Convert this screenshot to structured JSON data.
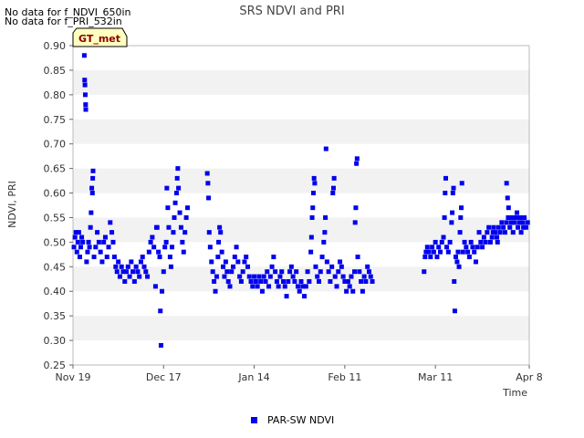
{
  "messages": [
    "No data for f_NDVI_650in",
    "No data for f_PRI_532in"
  ],
  "chart_data": {
    "type": "scatter",
    "title": "SRS NDVI and PRI",
    "xlabel": "Time",
    "ylabel": "NDVI, PRI",
    "site_badge": "GT_met",
    "ylim": [
      0.25,
      0.9
    ],
    "yticks": [
      "0.25",
      "0.30",
      "0.35",
      "0.40",
      "0.45",
      "0.50",
      "0.55",
      "0.60",
      "0.65",
      "0.70",
      "0.75",
      "0.80",
      "0.85",
      "0.90"
    ],
    "xlim_days": [
      0,
      141
    ],
    "xticks": [
      {
        "label": "Nov 19",
        "day": 0
      },
      {
        "label": "Dec 17",
        "day": 28
      },
      {
        "label": "Jan 14",
        "day": 56
      },
      {
        "label": "Feb 11",
        "day": 84
      },
      {
        "label": "Mar 11",
        "day": 112
      },
      {
        "label": "Apr 8",
        "day": 141
      }
    ],
    "grid": "alternating horizontal bands",
    "legend_position": "bottom-center",
    "colors": {
      "series": "#0000ee",
      "band": "#f2f2f2",
      "badge_fill": "#ffffc0"
    },
    "series": [
      {
        "name": "PAR-SW NDVI",
        "points": [
          [
            0.3,
            0.49
          ],
          [
            0.6,
            0.51
          ],
          [
            0.9,
            0.52
          ],
          [
            1.2,
            0.48
          ],
          [
            1.5,
            0.5
          ],
          [
            1.8,
            0.52
          ],
          [
            2.1,
            0.47
          ],
          [
            2.4,
            0.49
          ],
          [
            2.7,
            0.51
          ],
          [
            3.0,
            0.5
          ],
          [
            3.5,
            0.88
          ],
          [
            3.6,
            0.83
          ],
          [
            3.7,
            0.82
          ],
          [
            3.8,
            0.8
          ],
          [
            3.9,
            0.78
          ],
          [
            3.95,
            0.77
          ],
          [
            4.2,
            0.46
          ],
          [
            4.5,
            0.48
          ],
          [
            4.8,
            0.5
          ],
          [
            5.1,
            0.49
          ],
          [
            5.4,
            0.53
          ],
          [
            5.6,
            0.56
          ],
          [
            5.8,
            0.61
          ],
          [
            6.0,
            0.6
          ],
          [
            6.1,
            0.63
          ],
          [
            6.2,
            0.645
          ],
          [
            6.5,
            0.47
          ],
          [
            7.0,
            0.49
          ],
          [
            7.5,
            0.52
          ],
          [
            8.0,
            0.5
          ],
          [
            8.5,
            0.48
          ],
          [
            9.0,
            0.46
          ],
          [
            9.5,
            0.5
          ],
          [
            10.0,
            0.51
          ],
          [
            10.5,
            0.47
          ],
          [
            11.0,
            0.49
          ],
          [
            11.5,
            0.54
          ],
          [
            12.0,
            0.52
          ],
          [
            12.4,
            0.5
          ],
          [
            12.8,
            0.47
          ],
          [
            13.2,
            0.45
          ],
          [
            13.6,
            0.44
          ],
          [
            14.0,
            0.46
          ],
          [
            14.5,
            0.43
          ],
          [
            15.0,
            0.45
          ],
          [
            15.5,
            0.44
          ],
          [
            16.0,
            0.42
          ],
          [
            16.5,
            0.44
          ],
          [
            17.0,
            0.45
          ],
          [
            17.5,
            0.43
          ],
          [
            18.0,
            0.46
          ],
          [
            18.5,
            0.44
          ],
          [
            19.0,
            0.42
          ],
          [
            19.5,
            0.45
          ],
          [
            20.0,
            0.44
          ],
          [
            20.5,
            0.43
          ],
          [
            21.0,
            0.46
          ],
          [
            21.5,
            0.47
          ],
          [
            22.0,
            0.45
          ],
          [
            22.5,
            0.44
          ],
          [
            23.0,
            0.43
          ],
          [
            23.5,
            0.48
          ],
          [
            24.0,
            0.5
          ],
          [
            24.5,
            0.51
          ],
          [
            25.0,
            0.49
          ],
          [
            25.5,
            0.41
          ],
          [
            25.8,
            0.53
          ],
          [
            26.0,
            0.53
          ],
          [
            26.4,
            0.48
          ],
          [
            26.8,
            0.47
          ],
          [
            27.0,
            0.36
          ],
          [
            27.2,
            0.29
          ],
          [
            27.5,
            0.4
          ],
          [
            28.0,
            0.44
          ],
          [
            28.4,
            0.49
          ],
          [
            28.8,
            0.5
          ],
          [
            29.0,
            0.61
          ],
          [
            29.3,
            0.57
          ],
          [
            29.6,
            0.53
          ],
          [
            30.0,
            0.47
          ],
          [
            30.3,
            0.45
          ],
          [
            30.6,
            0.49
          ],
          [
            31.0,
            0.52
          ],
          [
            31.3,
            0.55
          ],
          [
            31.6,
            0.58
          ],
          [
            32.0,
            0.6
          ],
          [
            32.2,
            0.63
          ],
          [
            32.4,
            0.65
          ],
          [
            32.6,
            0.61
          ],
          [
            33.0,
            0.56
          ],
          [
            33.4,
            0.53
          ],
          [
            33.8,
            0.5
          ],
          [
            34.2,
            0.48
          ],
          [
            34.6,
            0.52
          ],
          [
            35.0,
            0.55
          ],
          [
            35.4,
            0.57
          ],
          [
            41.5,
            0.64
          ],
          [
            41.7,
            0.62
          ],
          [
            41.9,
            0.59
          ],
          [
            42.1,
            0.52
          ],
          [
            42.4,
            0.49
          ],
          [
            42.8,
            0.46
          ],
          [
            43.2,
            0.44
          ],
          [
            43.6,
            0.42
          ],
          [
            44.0,
            0.4
          ],
          [
            44.4,
            0.43
          ],
          [
            44.8,
            0.47
          ],
          [
            45.0,
            0.5
          ],
          [
            45.3,
            0.53
          ],
          [
            45.6,
            0.52
          ],
          [
            46.0,
            0.48
          ],
          [
            46.4,
            0.45
          ],
          [
            46.8,
            0.43
          ],
          [
            47.2,
            0.46
          ],
          [
            47.6,
            0.44
          ],
          [
            48.0,
            0.42
          ],
          [
            48.5,
            0.41
          ],
          [
            49.0,
            0.44
          ],
          [
            49.5,
            0.45
          ],
          [
            50.0,
            0.47
          ],
          [
            50.5,
            0.49
          ],
          [
            51.0,
            0.46
          ],
          [
            51.5,
            0.43
          ],
          [
            52.0,
            0.42
          ],
          [
            52.5,
            0.44
          ],
          [
            53.0,
            0.46
          ],
          [
            53.5,
            0.47
          ],
          [
            54.0,
            0.45
          ],
          [
            54.5,
            0.43
          ],
          [
            55.0,
            0.42
          ],
          [
            55.5,
            0.41
          ],
          [
            56.0,
            0.43
          ],
          [
            56.5,
            0.42
          ],
          [
            57.0,
            0.41
          ],
          [
            57.5,
            0.43
          ],
          [
            58.0,
            0.42
          ],
          [
            58.5,
            0.4
          ],
          [
            59.0,
            0.43
          ],
          [
            59.5,
            0.42
          ],
          [
            60.0,
            0.44
          ],
          [
            60.5,
            0.41
          ],
          [
            61.0,
            0.43
          ],
          [
            61.5,
            0.45
          ],
          [
            62.0,
            0.47
          ],
          [
            62.5,
            0.44
          ],
          [
            63.0,
            0.42
          ],
          [
            63.5,
            0.41
          ],
          [
            64.0,
            0.43
          ],
          [
            64.5,
            0.44
          ],
          [
            65.0,
            0.42
          ],
          [
            65.5,
            0.41
          ],
          [
            66.0,
            0.39
          ],
          [
            66.5,
            0.42
          ],
          [
            67.0,
            0.44
          ],
          [
            67.5,
            0.45
          ],
          [
            68.0,
            0.43
          ],
          [
            68.5,
            0.42
          ],
          [
            69.0,
            0.44
          ],
          [
            69.5,
            0.41
          ],
          [
            70.0,
            0.4
          ],
          [
            70.5,
            0.42
          ],
          [
            71.0,
            0.41
          ],
          [
            71.5,
            0.39
          ],
          [
            72.0,
            0.41
          ],
          [
            72.5,
            0.44
          ],
          [
            73.0,
            0.42
          ],
          [
            73.5,
            0.48
          ],
          [
            73.7,
            0.51
          ],
          [
            73.9,
            0.55
          ],
          [
            74.1,
            0.57
          ],
          [
            74.3,
            0.6
          ],
          [
            74.5,
            0.63
          ],
          [
            74.7,
            0.62
          ],
          [
            75.0,
            0.45
          ],
          [
            75.5,
            0.43
          ],
          [
            76.0,
            0.42
          ],
          [
            76.5,
            0.44
          ],
          [
            77.0,
            0.47
          ],
          [
            77.5,
            0.5
          ],
          [
            77.8,
            0.52
          ],
          [
            78.0,
            0.55
          ],
          [
            78.2,
            0.69
          ],
          [
            78.5,
            0.46
          ],
          [
            79.0,
            0.44
          ],
          [
            79.5,
            0.42
          ],
          [
            80.0,
            0.45
          ],
          [
            80.3,
            0.6
          ],
          [
            80.5,
            0.61
          ],
          [
            80.7,
            0.63
          ],
          [
            81.0,
            0.43
          ],
          [
            81.5,
            0.41
          ],
          [
            82.0,
            0.44
          ],
          [
            82.5,
            0.46
          ],
          [
            83.0,
            0.45
          ],
          [
            83.5,
            0.43
          ],
          [
            84.0,
            0.42
          ],
          [
            84.5,
            0.4
          ],
          [
            85.0,
            0.42
          ],
          [
            85.5,
            0.41
          ],
          [
            86.0,
            0.43
          ],
          [
            86.5,
            0.4
          ],
          [
            87.0,
            0.44
          ],
          [
            87.2,
            0.54
          ],
          [
            87.4,
            0.57
          ],
          [
            87.6,
            0.66
          ],
          [
            87.8,
            0.67
          ],
          [
            88.0,
            0.47
          ],
          [
            88.5,
            0.44
          ],
          [
            89.0,
            0.42
          ],
          [
            89.5,
            0.4
          ],
          [
            90.0,
            0.43
          ],
          [
            90.5,
            0.42
          ],
          [
            91.0,
            0.45
          ],
          [
            91.5,
            0.44
          ],
          [
            92.0,
            0.43
          ],
          [
            92.5,
            0.42
          ],
          [
            108.5,
            0.44
          ],
          [
            108.8,
            0.47
          ],
          [
            109.1,
            0.48
          ],
          [
            109.5,
            0.49
          ],
          [
            110.0,
            0.48
          ],
          [
            110.5,
            0.47
          ],
          [
            111.0,
            0.49
          ],
          [
            111.5,
            0.48
          ],
          [
            112.0,
            0.5
          ],
          [
            112.5,
            0.47
          ],
          [
            113.0,
            0.49
          ],
          [
            113.5,
            0.48
          ],
          [
            114.0,
            0.5
          ],
          [
            114.5,
            0.51
          ],
          [
            114.8,
            0.55
          ],
          [
            115.0,
            0.6
          ],
          [
            115.2,
            0.63
          ],
          [
            115.5,
            0.49
          ],
          [
            116.0,
            0.48
          ],
          [
            116.5,
            0.5
          ],
          [
            117.0,
            0.54
          ],
          [
            117.2,
            0.56
          ],
          [
            117.4,
            0.6
          ],
          [
            117.6,
            0.61
          ],
          [
            117.8,
            0.42
          ],
          [
            118.0,
            0.36
          ],
          [
            118.3,
            0.47
          ],
          [
            118.7,
            0.46
          ],
          [
            119.0,
            0.48
          ],
          [
            119.3,
            0.45
          ],
          [
            119.6,
            0.52
          ],
          [
            119.8,
            0.55
          ],
          [
            120.0,
            0.57
          ],
          [
            120.2,
            0.62
          ],
          [
            120.5,
            0.48
          ],
          [
            121.0,
            0.5
          ],
          [
            121.5,
            0.49
          ],
          [
            122.0,
            0.48
          ],
          [
            122.5,
            0.47
          ],
          [
            123.0,
            0.5
          ],
          [
            123.5,
            0.49
          ],
          [
            124.0,
            0.48
          ],
          [
            124.5,
            0.46
          ],
          [
            125.0,
            0.49
          ],
          [
            125.5,
            0.52
          ],
          [
            126.0,
            0.5
          ],
          [
            126.5,
            0.49
          ],
          [
            127.0,
            0.51
          ],
          [
            127.5,
            0.5
          ],
          [
            128.0,
            0.52
          ],
          [
            128.5,
            0.53
          ],
          [
            129.0,
            0.5
          ],
          [
            129.5,
            0.51
          ],
          [
            130.0,
            0.53
          ],
          [
            130.5,
            0.52
          ],
          [
            131.0,
            0.51
          ],
          [
            131.5,
            0.53
          ],
          [
            132.0,
            0.52
          ],
          [
            132.5,
            0.54
          ],
          [
            133.0,
            0.53
          ],
          [
            133.5,
            0.52
          ],
          [
            134.0,
            0.54
          ],
          [
            134.5,
            0.55
          ],
          [
            135.0,
            0.53
          ],
          [
            135.5,
            0.54
          ],
          [
            136.0,
            0.52
          ],
          [
            136.5,
            0.54
          ],
          [
            137.0,
            0.55
          ],
          [
            137.5,
            0.53
          ],
          [
            138.0,
            0.54
          ],
          [
            138.5,
            0.52
          ],
          [
            139.0,
            0.54
          ],
          [
            139.5,
            0.55
          ],
          [
            140.0,
            0.53
          ],
          [
            140.5,
            0.54
          ],
          [
            134.0,
            0.62
          ],
          [
            134.3,
            0.59
          ],
          [
            134.6,
            0.57
          ],
          [
            135.2,
            0.55
          ],
          [
            136.2,
            0.55
          ],
          [
            137.2,
            0.56
          ],
          [
            138.2,
            0.55
          ],
          [
            139.2,
            0.53
          ],
          [
            131.2,
            0.5
          ],
          [
            129.8,
            0.52
          ]
        ]
      }
    ]
  }
}
